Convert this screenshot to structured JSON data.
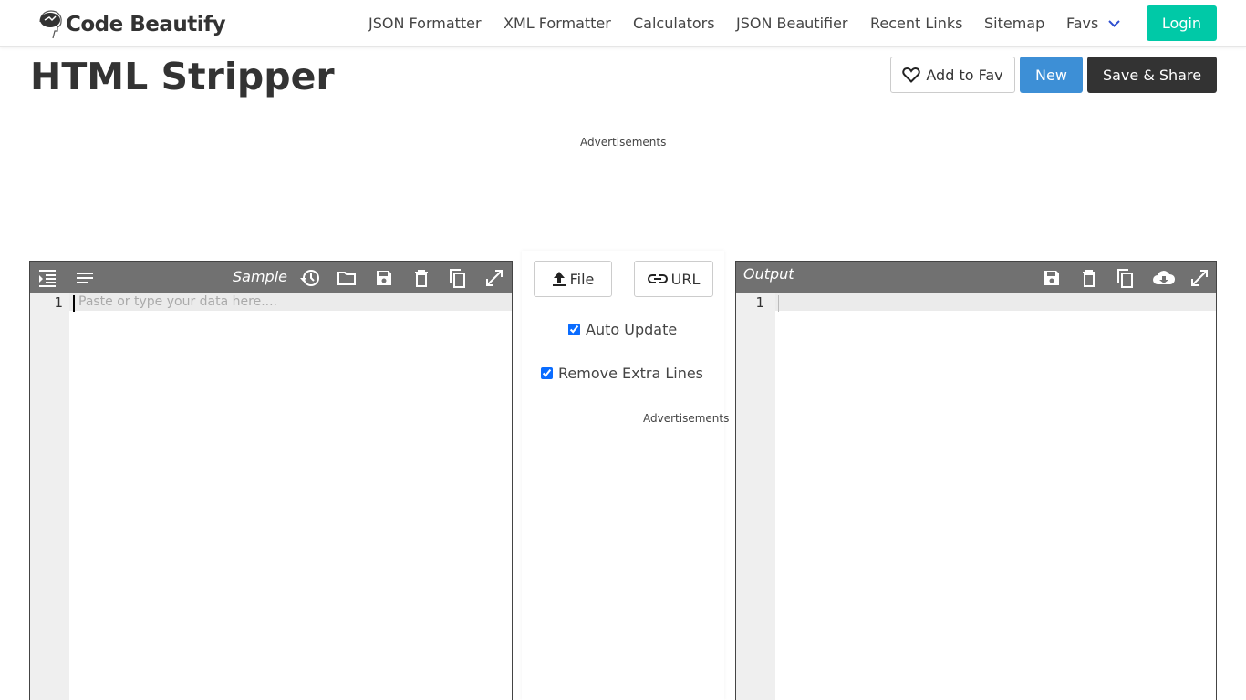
{
  "header": {
    "logo_text": "Code Beautify",
    "nav": [
      "JSON Formatter",
      "XML Formatter",
      "Calculators",
      "JSON Beautifier",
      "Recent Links",
      "Sitemap",
      "Favs"
    ],
    "login": "Login"
  },
  "page": {
    "title": "HTML Stripper",
    "add_fav": "Add to Fav",
    "new": "New",
    "save_share": "Save & Share",
    "ads_label": "Advertisements"
  },
  "input_editor": {
    "sample_label": "Sample",
    "line_number": "1",
    "placeholder": "Paste or type your data here...."
  },
  "middle": {
    "file": "File",
    "url": "URL",
    "auto_update": "Auto Update",
    "remove_extra_lines": "Remove Extra Lines",
    "ads_label": "Advertisements"
  },
  "output_editor": {
    "label": "Output",
    "line_number": "1"
  },
  "colors": {
    "accent": "#00c9a7",
    "new_button": "#3d8fd6",
    "dark_button": "#333333",
    "toolbar": "#717171"
  }
}
